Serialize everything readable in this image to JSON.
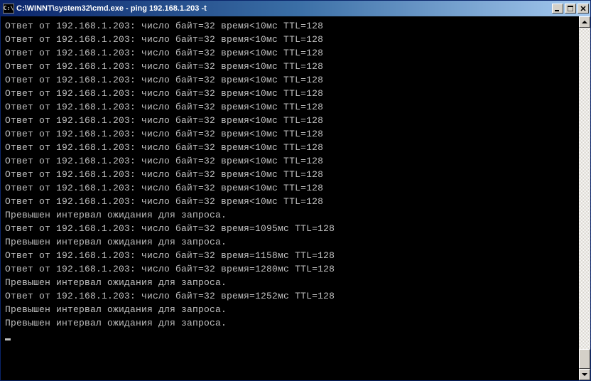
{
  "window": {
    "icon_label": "C:\\",
    "title": "C:\\WINNT\\system32\\cmd.exe - ping 192.168.1.203 -t"
  },
  "console": {
    "lines": [
      "Ответ от 192.168.1.203: число байт=32 время<10мс TTL=128",
      "Ответ от 192.168.1.203: число байт=32 время<10мс TTL=128",
      "Ответ от 192.168.1.203: число байт=32 время<10мс TTL=128",
      "Ответ от 192.168.1.203: число байт=32 время<10мс TTL=128",
      "Ответ от 192.168.1.203: число байт=32 время<10мс TTL=128",
      "Ответ от 192.168.1.203: число байт=32 время<10мс TTL=128",
      "Ответ от 192.168.1.203: число байт=32 время<10мс TTL=128",
      "Ответ от 192.168.1.203: число байт=32 время<10мс TTL=128",
      "Ответ от 192.168.1.203: число байт=32 время<10мс TTL=128",
      "Ответ от 192.168.1.203: число байт=32 время<10мс TTL=128",
      "Ответ от 192.168.1.203: число байт=32 время<10мс TTL=128",
      "Ответ от 192.168.1.203: число байт=32 время<10мс TTL=128",
      "Ответ от 192.168.1.203: число байт=32 время<10мс TTL=128",
      "Ответ от 192.168.1.203: число байт=32 время<10мс TTL=128",
      "Превышен интервал ожидания для запроса.",
      "Ответ от 192.168.1.203: число байт=32 время=1095мс TTL=128",
      "Превышен интервал ожидания для запроса.",
      "Ответ от 192.168.1.203: число байт=32 время=1158мс TTL=128",
      "Ответ от 192.168.1.203: число байт=32 время=1280мс TTL=128",
      "Превышен интервал ожидания для запроса.",
      "Ответ от 192.168.1.203: число байт=32 время=1252мс TTL=128",
      "Превышен интервал ожидания для запроса.",
      "Превышен интервал ожидания для запроса."
    ]
  }
}
